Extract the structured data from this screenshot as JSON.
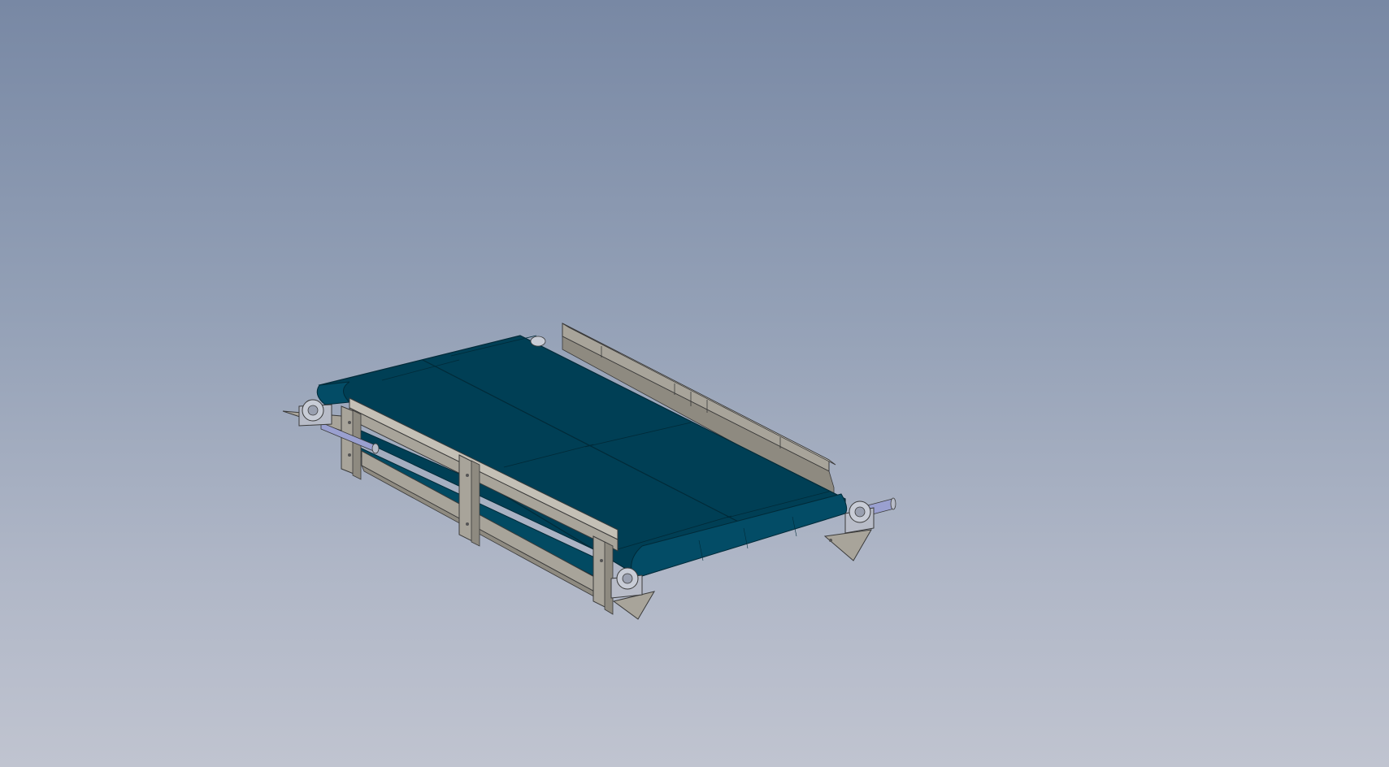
{
  "viewport": {
    "background_top": "#7888a4",
    "background_bottom": "#c0c4d0"
  },
  "model": {
    "subject": "belt-conveyor-assembly",
    "belt_color": "#003f55",
    "belt_edge_color": "#012a38",
    "frame_color": "#a8a49a",
    "frame_dark": "#8a867c",
    "bearing_color": "#b8bcc8",
    "shaft_color": "#9aa0d0"
  }
}
